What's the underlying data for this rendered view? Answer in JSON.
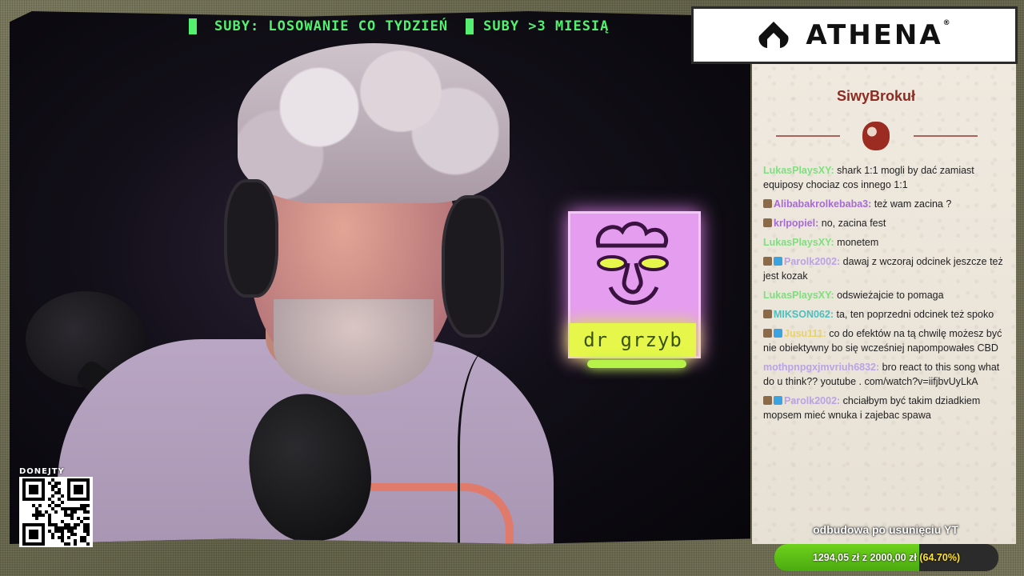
{
  "ticker": {
    "text_1": "SUBY: LOSOWANIE CO TYDZIEŃ",
    "text_2": "SUBY >3 MIESIĄ"
  },
  "neon_sign": {
    "label": "dr grzyb"
  },
  "qr": {
    "title": "DONEJTY"
  },
  "logo": {
    "name": "ATHENA",
    "mark": "®"
  },
  "chat": {
    "title": "SiwyBrokuł",
    "messages": [
      {
        "user": "LukasPlaysXY",
        "user_color": "#7de07d",
        "badges": [],
        "text": "shark 1:1 mogli by dać zamiast equiposy chociaz cos innego 1:1"
      },
      {
        "user": "Alibabakrolkebaba3",
        "user_color": "#a86ad9",
        "badges": [
          "a"
        ],
        "text": "też wam zacina ?"
      },
      {
        "user": "krlpopiel",
        "user_color": "#a86ad9",
        "badges": [
          "a"
        ],
        "text": "no, zacina fest"
      },
      {
        "user": "LukasPlaysXY",
        "user_color": "#7de07d",
        "badges": [],
        "text": "monetem"
      },
      {
        "user": "Parolk2002",
        "user_color": "#b9a2e6",
        "badges": [
          "a",
          "b"
        ],
        "text": "dawaj z wczoraj odcinek jeszcze też jest kozak"
      },
      {
        "user": "LukasPlaysXY",
        "user_color": "#7de07d",
        "badges": [],
        "text": "odswieżajcie to pomaga"
      },
      {
        "user": "MIKSON062",
        "user_color": "#4cc0c0",
        "badges": [
          "a"
        ],
        "text": "ta, ten poprzedni odcinek też spoko"
      },
      {
        "user": "Jusu111",
        "user_color": "#e8d26a",
        "badges": [
          "a",
          "b"
        ],
        "text": "co do efektów na tą chwilę możesz być nie obiektywny bo się wcześniej napompowałes CBD"
      },
      {
        "user": "mothpnpgxjmvriuh6832",
        "user_color": "#b9a2e6",
        "badges": [],
        "text": "bro react to this song what do u think?? youtube . com/watch?v=iifjbvUyLkA"
      },
      {
        "user": "Parolk2002",
        "user_color": "#b9a2e6",
        "badges": [
          "a",
          "b"
        ],
        "text": "chciałbym być takim dziadkiem mopsem mieć wnuka i zajebac spawa"
      }
    ]
  },
  "donation": {
    "title": "odbudowa po usunięciu YT",
    "current": "1294,05 zł",
    "separator": "z",
    "goal": "2000,00 zł",
    "percent_label": "(64.70%)",
    "progress": 0.647
  },
  "colors": {
    "ticker_green": "#54f070",
    "chat_title": "#8c2b22",
    "progress_green": "#5fc41a"
  }
}
